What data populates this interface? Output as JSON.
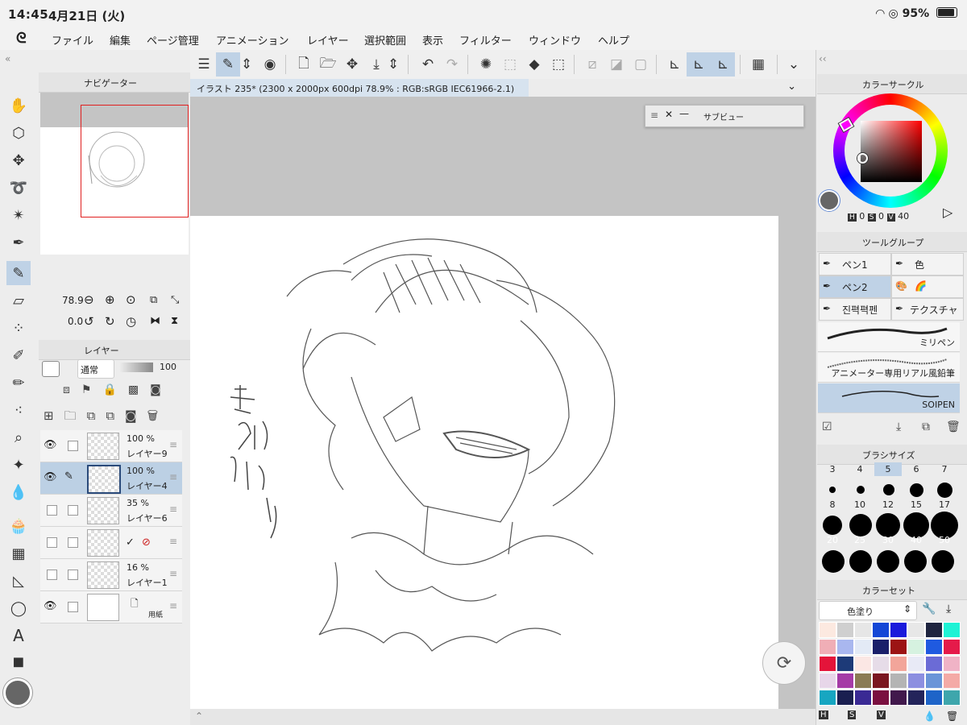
{
  "status": {
    "time": "14:45",
    "date": "4月21日 (火)",
    "battery": "95%"
  },
  "menu": [
    "ファイル",
    "編集",
    "ページ管理",
    "アニメーション",
    "レイヤー",
    "選択範囲",
    "表示",
    "フィルター",
    "ウィンドウ",
    "ヘルプ"
  ],
  "document": {
    "tab_title": "イラスト 235* (2300 x 2000px 600dpi 78.9% : RGB:sRGB IEC61966-2.1)"
  },
  "subview": {
    "title": "サブビュー"
  },
  "navigator": {
    "title": "ナビゲーター",
    "zoom": "78.9",
    "rotation": "0.0"
  },
  "layers": {
    "title": "レイヤー",
    "blend_mode": "通常",
    "opacity": "100",
    "rows": [
      {
        "opacity": "100 %",
        "name": "レイヤー9",
        "visible": true,
        "selected": false
      },
      {
        "opacity": "100 %",
        "name": "レイヤー4",
        "visible": true,
        "selected": true
      },
      {
        "opacity": "35 %",
        "name": "レイヤー6",
        "visible": false,
        "selected": false
      },
      {
        "opacity": "",
        "name": "",
        "visible": false,
        "selected": false
      },
      {
        "opacity": "16 %",
        "name": "レイヤー1",
        "visible": false,
        "selected": false
      },
      {
        "opacity": "",
        "name": "用紙",
        "visible": true,
        "selected": false
      }
    ]
  },
  "color_circle": {
    "title": "カラーサークル",
    "h": "0",
    "s": "0",
    "v": "40",
    "h_label": "H",
    "s_label": "S",
    "v_label": "V"
  },
  "tool_group": {
    "title": "ツールグループ",
    "items": [
      "ペン1",
      "色",
      "ペン2",
      "🌈",
      "진펵펵펜",
      "テクスチャ"
    ]
  },
  "brushes": [
    "ミリペン",
    "アニメーター専用リアル風鉛筆",
    "SOIPEN"
  ],
  "brush_size": {
    "title": "ブラシサイズ",
    "sizes": [
      "3",
      "4",
      "5",
      "6",
      "7",
      "8",
      "10",
      "12",
      "15",
      "17",
      "20",
      "25",
      "30",
      "40",
      "50"
    ]
  },
  "color_set": {
    "title": "カラーセット",
    "preset": "色塗り",
    "colors": [
      "#fce9e0",
      "#cfcfcf",
      "#e6e6e6",
      "#1547d6",
      "#1a1adb",
      "#e7e7e7",
      "#1f2540",
      "#1ef2d5",
      "#f0aeb6",
      "#a9b7ef",
      "#e3eaf6",
      "#1a1f6a",
      "#9c1414",
      "#d6f2e0",
      "#1f5ae0",
      "#e51a4a",
      "#e4143a",
      "#1d3a78",
      "#fbe7e4",
      "#e6dce8",
      "#f2a59a",
      "#e8eaf6",
      "#6b6bd6",
      "#f0b3c6",
      "#e7d6e9",
      "#a53ba6",
      "#8a7b54",
      "#7a1620",
      "#b4b4b4",
      "#8c8fe0",
      "#6a95d8",
      "#f4aaa6",
      "#17a6c1",
      "#1a1f50",
      "#3a2a94",
      "#7a1040",
      "#41184c",
      "#23245a",
      "#1e64c8",
      "#3ea6ac"
    ]
  }
}
